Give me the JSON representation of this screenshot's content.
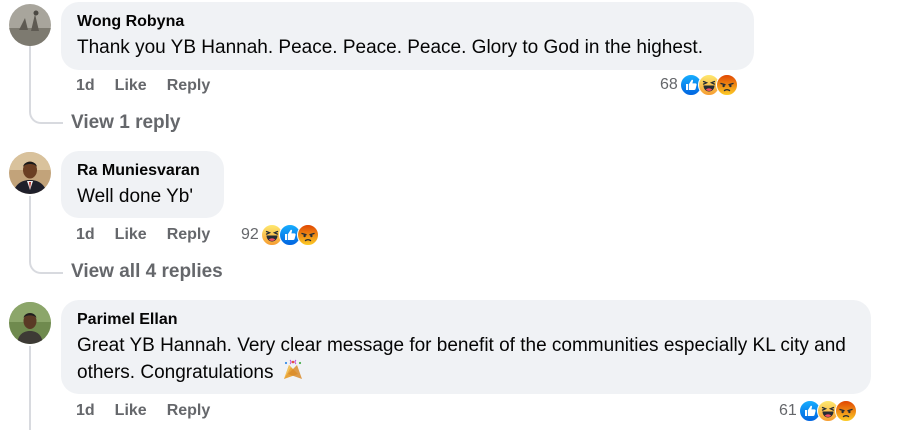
{
  "comments": [
    {
      "author": "Wong Robyna",
      "text": "Thank you YB Hannah. Peace. Peace. Peace. Glory to God in the highest.",
      "time": "1d",
      "like": "Like",
      "reply": "Reply",
      "reaction_count": "68",
      "reactions": [
        "like-icon",
        "haha-icon",
        "angry-icon"
      ],
      "replies_link": "View 1 reply"
    },
    {
      "author": "Ra Muniesvaran",
      "text": "Well done Yb'",
      "time": "1d",
      "like": "Like",
      "reply": "Reply",
      "reaction_count": "92",
      "reactions": [
        "haha-icon",
        "like-icon",
        "angry-icon"
      ],
      "replies_link": "View all 4 replies"
    },
    {
      "author": "Parimel Ellan",
      "text": "Great YB Hannah. Very clear message for benefit of the communities especially KL city and others. Congratulations",
      "text_emoji": "party-popper-icon",
      "time": "1d",
      "like": "Like",
      "reply": "Reply",
      "reaction_count": "61",
      "reactions": [
        "like-icon",
        "haha-icon",
        "angry-icon"
      ]
    }
  ],
  "colors": {
    "bubble": "#f0f2f5",
    "meta_text": "#65676b",
    "like_blue": "#1877f2",
    "haha_yellow": "#f7b928",
    "angry_red": "#e9710f"
  }
}
